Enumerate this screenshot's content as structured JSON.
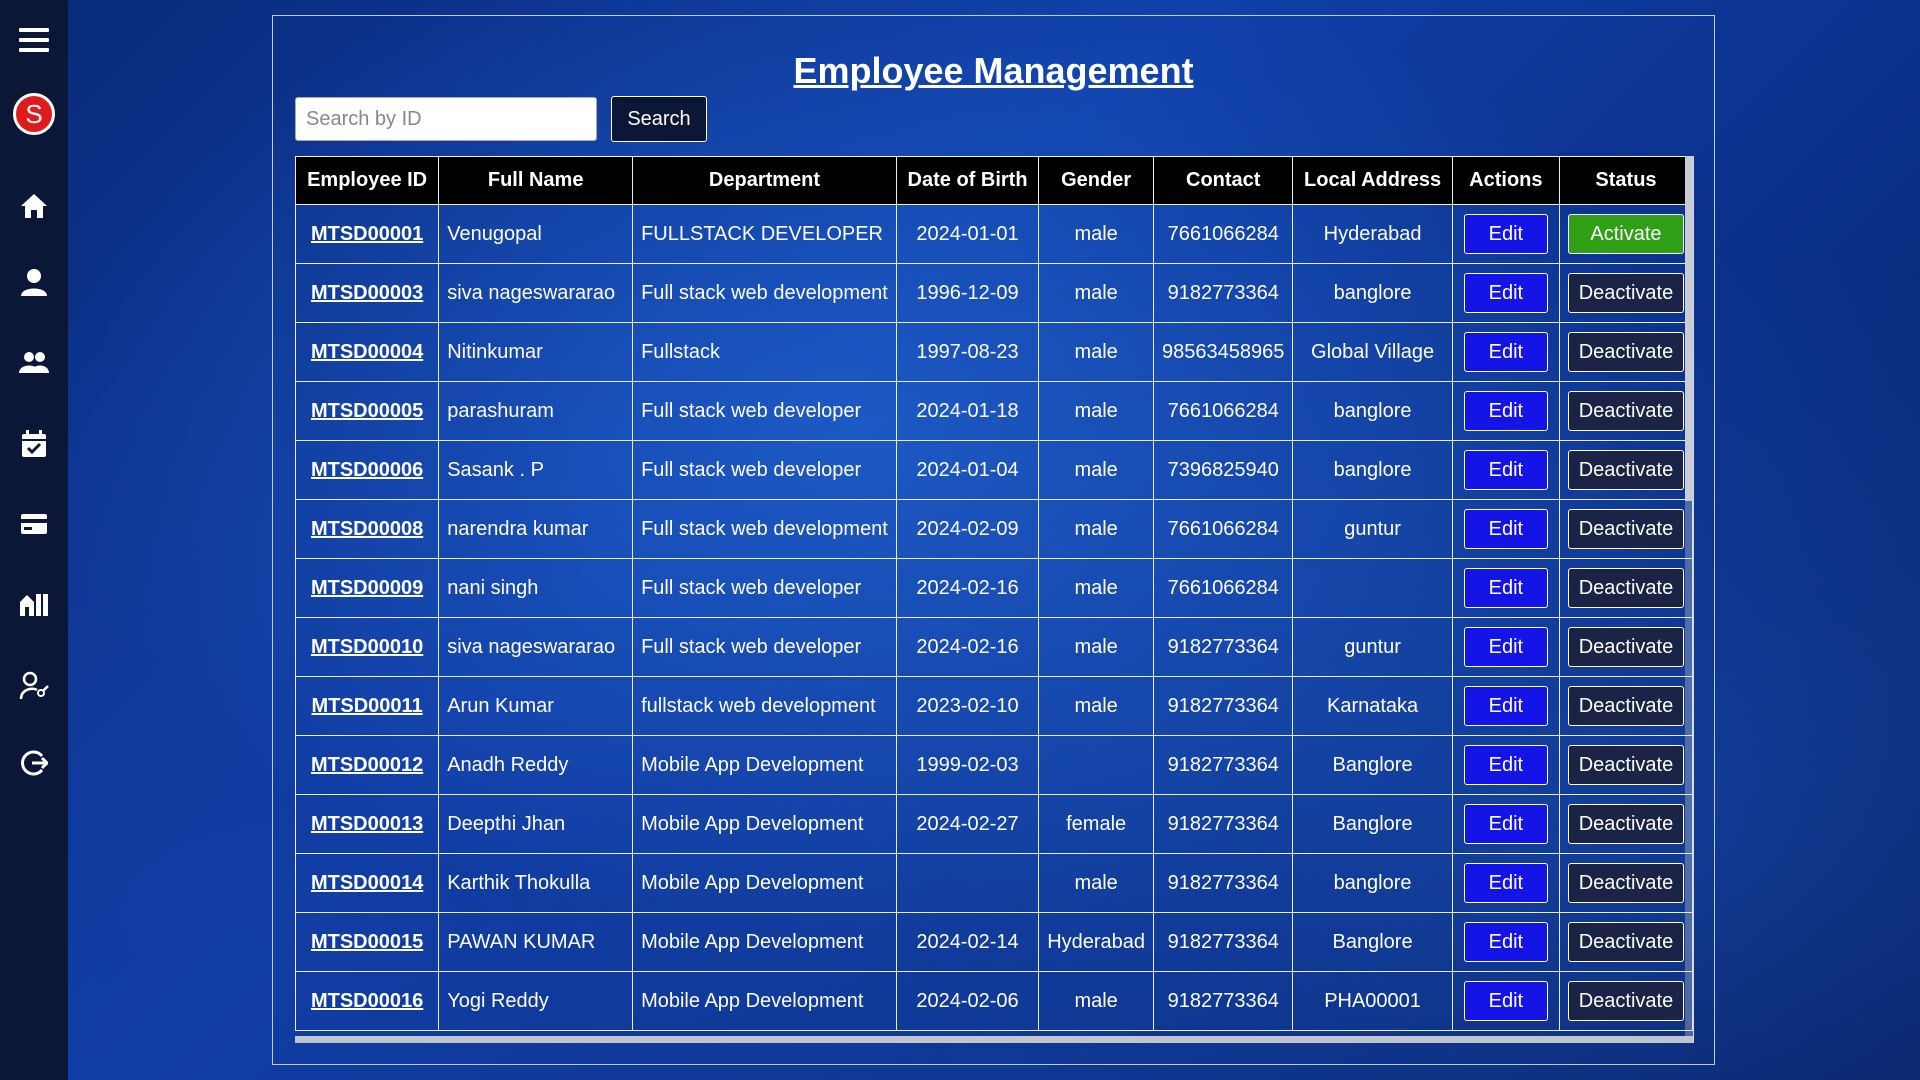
{
  "sidebar": {
    "avatar_letter": "S",
    "icons": [
      "menu-icon",
      "avatar",
      "home-icon",
      "person-icon",
      "group-icon",
      "calendar-check-icon",
      "credit-card-icon",
      "building-icon",
      "user-key-icon",
      "logout-icon"
    ]
  },
  "page": {
    "title": "Employee Management"
  },
  "search": {
    "placeholder": "Search by ID",
    "value": "",
    "button_label": "Search"
  },
  "table": {
    "columns": [
      "Employee ID",
      "Full Name",
      "Department",
      "Date of Birth",
      "Gender",
      "Contact",
      "Local Address",
      "Actions",
      "Status"
    ],
    "edit_label": "Edit",
    "rows": [
      {
        "id": "MTSD00001",
        "name": "Venugopal",
        "department": "FULLSTACK DEVELOPER",
        "dob": "2024-01-01",
        "gender": "male",
        "contact": "7661066284",
        "address": "Hyderabad",
        "status": "Activate"
      },
      {
        "id": "MTSD00003",
        "name": "siva nageswararao",
        "department": "Full stack web development",
        "dob": "1996-12-09",
        "gender": "male",
        "contact": "9182773364",
        "address": "banglore",
        "status": "Deactivate"
      },
      {
        "id": "MTSD00004",
        "name": "Nitinkumar",
        "department": "Fullstack",
        "dob": "1997-08-23",
        "gender": "male",
        "contact": "98563458965",
        "address": "Global Village",
        "status": "Deactivate"
      },
      {
        "id": "MTSD00005",
        "name": "parashuram",
        "department": "Full stack web developer",
        "dob": "2024-01-18",
        "gender": "male",
        "contact": "7661066284",
        "address": "banglore",
        "status": "Deactivate"
      },
      {
        "id": "MTSD00006",
        "name": "Sasank . P",
        "department": "Full stack web developer",
        "dob": "2024-01-04",
        "gender": "male",
        "contact": "7396825940",
        "address": "banglore",
        "status": "Deactivate"
      },
      {
        "id": "MTSD00008",
        "name": "narendra kumar",
        "department": "Full stack web development",
        "dob": "2024-02-09",
        "gender": "male",
        "contact": "7661066284",
        "address": "guntur",
        "status": "Deactivate"
      },
      {
        "id": "MTSD00009",
        "name": "nani singh",
        "department": "Full stack web developer",
        "dob": "2024-02-16",
        "gender": "male",
        "contact": "7661066284",
        "address": "",
        "status": "Deactivate"
      },
      {
        "id": "MTSD00010",
        "name": "siva nageswararao",
        "department": "Full stack web developer",
        "dob": "2024-02-16",
        "gender": "male",
        "contact": "9182773364",
        "address": "guntur",
        "status": "Deactivate"
      },
      {
        "id": "MTSD00011",
        "name": "Arun Kumar",
        "department": "fullstack web development",
        "dob": "2023-02-10",
        "gender": "male",
        "contact": "9182773364",
        "address": "Karnataka",
        "status": "Deactivate"
      },
      {
        "id": "MTSD00012",
        "name": "Anadh Reddy",
        "department": "Mobile App Development",
        "dob": "1999-02-03",
        "gender": "",
        "contact": "9182773364",
        "address": "Banglore",
        "status": "Deactivate"
      },
      {
        "id": "MTSD00013",
        "name": "Deepthi Jhan",
        "department": "Mobile App Development",
        "dob": "2024-02-27",
        "gender": "female",
        "contact": "9182773364",
        "address": "Banglore",
        "status": "Deactivate"
      },
      {
        "id": "MTSD00014",
        "name": "Karthik Thokulla",
        "department": "Mobile App Development",
        "dob": "",
        "gender": "male",
        "contact": "9182773364",
        "address": "banglore",
        "status": "Deactivate"
      },
      {
        "id": "MTSD00015",
        "name": "PAWAN KUMAR",
        "department": "Mobile App Development",
        "dob": "2024-02-14",
        "gender": "Hyderabad",
        "contact": "9182773364",
        "address": "Banglore",
        "status": "Deactivate"
      },
      {
        "id": "MTSD00016",
        "name": "Yogi Reddy",
        "department": "Mobile App Development",
        "dob": "2024-02-06",
        "gender": "male",
        "contact": "9182773364",
        "address": "PHA00001",
        "status": "Deactivate"
      }
    ]
  },
  "colors": {
    "sidebar_bg": "#0c1636",
    "edit_button": "#1414e6",
    "activate_button": "#2fa015",
    "deactivate_button": "#1b2447",
    "avatar": "#e01b1b"
  }
}
